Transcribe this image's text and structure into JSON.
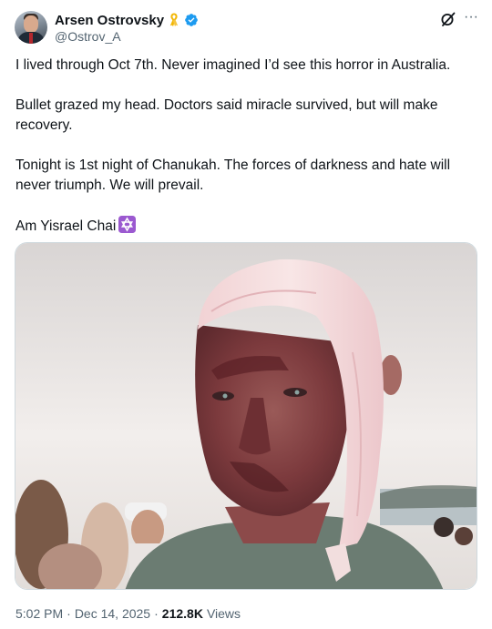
{
  "author": {
    "display_name": "Arsen Ostrovsky",
    "handle": "@Ostrov_A",
    "avatar_icon": "profile-photo",
    "badges": [
      "yellow-ribbon-icon",
      "verified-badge-icon"
    ],
    "verified_color": "#1d9bf0",
    "ribbon_color": "#f5c542"
  },
  "header_actions": {
    "grok_icon": "grok-icon",
    "more_icon": "more-options-icon",
    "more_glyph": "···"
  },
  "tweet": {
    "paragraphs": [
      "I lived through Oct 7th. Never imagined I’d see this horror in Australia.",
      "Bullet grazed my head. Doctors said miracle survived, but will make recovery.",
      "Tonight is 1st night of Chanukah. The forces of darkness and hate will never triumph. We will prevail.",
      "Am Yisrael Chai"
    ],
    "emoji": "star-of-david-icon",
    "emoji_color": "#9b59d0"
  },
  "media": {
    "kind": "photo",
    "subject": "man-with-head-bandage-photo"
  },
  "meta": {
    "time": "5:02 PM",
    "separator": "·",
    "date": "Dec 14, 2025",
    "views_count": "212.8K",
    "views_label": "Views"
  },
  "colors": {
    "text_primary": "#0f1419",
    "text_secondary": "#536471",
    "border": "#cfd9de"
  }
}
